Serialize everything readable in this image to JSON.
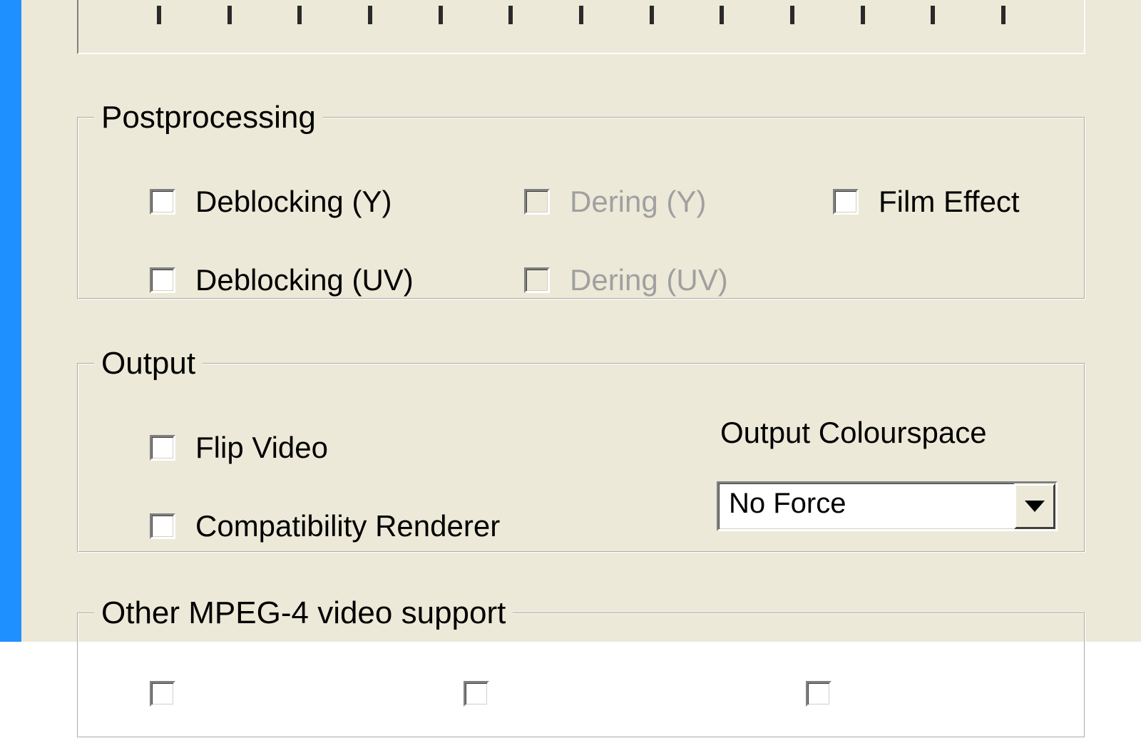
{
  "ticks_count": 13,
  "groups": {
    "postprocessing": {
      "legend": "Postprocessing",
      "deblocking_y": "Deblocking (Y)",
      "deblocking_uv": "Deblocking (UV)",
      "dering_y": "Dering (Y)",
      "dering_uv": "Dering (UV)",
      "film_effect": "Film Effect"
    },
    "output": {
      "legend": "Output",
      "flip_video": "Flip Video",
      "compat_renderer": "Compatibility Renderer",
      "colourspace_label": "Output Colourspace",
      "colourspace_value": "No Force"
    },
    "mpeg4": {
      "legend": "Other MPEG-4 video support"
    }
  }
}
